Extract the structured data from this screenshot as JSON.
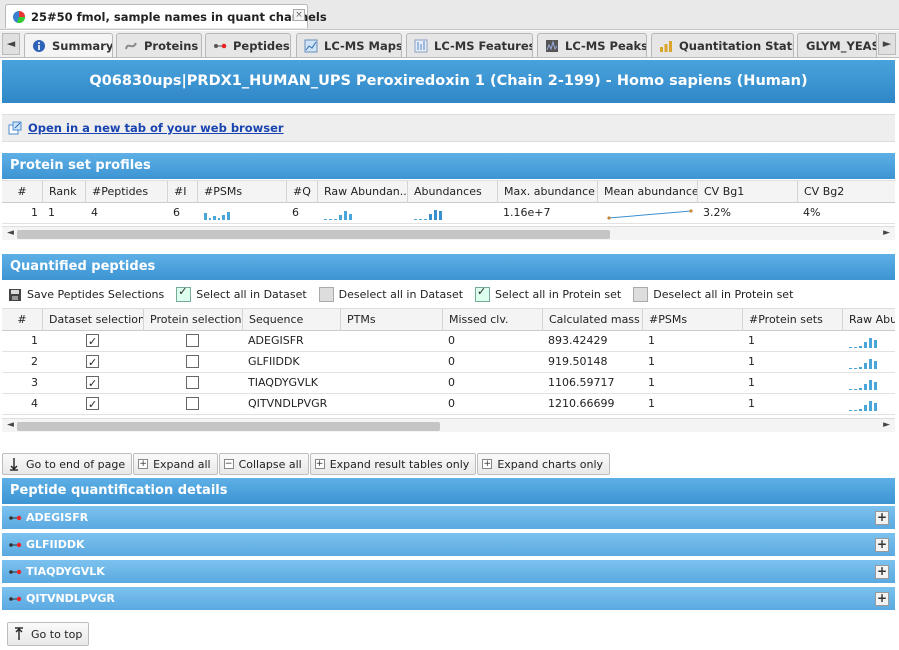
{
  "document_tab": {
    "title": "25#50 fmol, sample names in quant channels",
    "close": "×"
  },
  "view_tabs": {
    "left_arrow": "◄",
    "right_arrow": "►",
    "items": [
      {
        "label": "Summary"
      },
      {
        "label": "Proteins"
      },
      {
        "label": "Peptides"
      },
      {
        "label": "LC-MS Maps"
      },
      {
        "label": "LC-MS Features"
      },
      {
        "label": "LC-MS Peaks"
      },
      {
        "label": "Quantitation Stats"
      },
      {
        "label": "GLYM_YEAST"
      }
    ]
  },
  "banner": {
    "title": "Q06830ups|PRDX1_HUMAN_UPS Peroxiredoxin 1 (Chain 2-199) - Homo sapiens (Human)"
  },
  "open_link": {
    "label": "Open in a new tab of your web browser"
  },
  "protein_set_profiles": {
    "title": "Protein set profiles",
    "columns": [
      "#",
      "Rank",
      "#Peptides",
      "#I",
      "#PSMs",
      "#Q",
      "Raw Abundan...",
      "Abundances",
      "Max. abundance",
      "Mean abundances",
      "CV Bg1",
      "CV Bg2"
    ],
    "row": {
      "index": "1",
      "rank": "1",
      "peptides": "4",
      "i": "6",
      "q": "6",
      "max_abundance": "1.16e+7",
      "cv_bg1": "3.2%",
      "cv_bg2": "4%"
    }
  },
  "quantified_peptides": {
    "title": "Quantified peptides",
    "toolbar": {
      "save": "Save Peptides Selections",
      "select_all_dataset": "Select all in Dataset",
      "deselect_all_dataset": "Deselect all in Dataset",
      "select_all_protein_set": "Select all in Protein set",
      "deselect_all_protein_set": "Deselect all in Protein set"
    },
    "columns": [
      "#",
      "Dataset selection",
      "Protein selection",
      "Sequence",
      "PTMs",
      "Missed clv.",
      "Calculated mass",
      "#PSMs",
      "#Protein sets",
      "Raw Abun"
    ],
    "rows": [
      {
        "index": "1",
        "dataset_selected": true,
        "protein_selected": false,
        "sequence": "ADEGISFR",
        "ptms": "",
        "missed": "0",
        "mass": "893.42429",
        "psms": "1",
        "protein_sets": "1"
      },
      {
        "index": "2",
        "dataset_selected": true,
        "protein_selected": false,
        "sequence": "GLFIIDDK",
        "ptms": "",
        "missed": "0",
        "mass": "919.50148",
        "psms": "1",
        "protein_sets": "1"
      },
      {
        "index": "3",
        "dataset_selected": true,
        "protein_selected": false,
        "sequence": "TIAQDYGVLK",
        "ptms": "",
        "missed": "0",
        "mass": "1106.59717",
        "psms": "1",
        "protein_sets": "1"
      },
      {
        "index": "4",
        "dataset_selected": true,
        "protein_selected": false,
        "sequence": "QITVNDLPVGR",
        "ptms": "",
        "missed": "0",
        "mass": "1210.66699",
        "psms": "1",
        "protein_sets": "1"
      }
    ]
  },
  "actions": {
    "go_to_end": "Go to end of page",
    "expand_all": "Expand all",
    "collapse_all": "Collapse all",
    "expand_result_tables": "Expand result tables only",
    "expand_charts": "Expand charts only"
  },
  "peptide_quant_details": {
    "title": "Peptide quantification details",
    "items": [
      "ADEGISFR",
      "GLFIIDDK",
      "TIAQDYGVLK",
      "QITVNDLPVGR"
    ],
    "expand_label": "+"
  },
  "go_to_top": "Go to top",
  "colors": {
    "header_blue": "#3c94d3",
    "detail_blue": "#5aa9e0",
    "spark_blue": "#4aa6d8",
    "link": "#1a44b0"
  }
}
